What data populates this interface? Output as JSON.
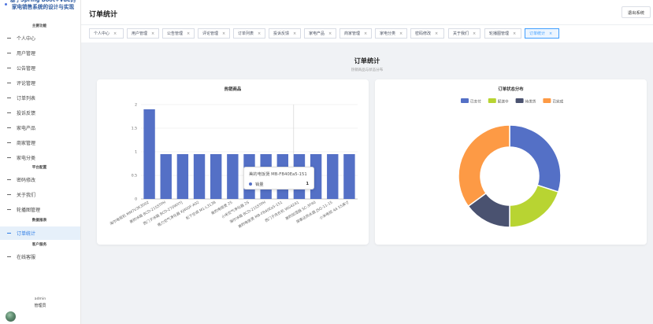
{
  "sidebar": {
    "brand": "基于Spring Boot+Vue的家电销售系统的设计与实现",
    "groups": [
      "主要功能",
      "平台配置",
      "数据报表",
      "客户服务"
    ],
    "items": [
      {
        "label": "个人中心"
      },
      {
        "label": "用户管理"
      },
      {
        "label": "公告管理"
      },
      {
        "label": "评论管理"
      },
      {
        "label": "订单列表"
      },
      {
        "label": "投诉反馈"
      },
      {
        "label": "家电产品"
      },
      {
        "label": "商家管理"
      },
      {
        "label": "家电分类"
      },
      {
        "label": "密码修改"
      },
      {
        "label": "关于我们"
      },
      {
        "label": "轮播图管理"
      },
      {
        "label": "订单统计"
      },
      {
        "label": "在线客服"
      }
    ],
    "active_item": "订单统计",
    "user": {
      "name": "admin",
      "role": "管理员"
    }
  },
  "header": {
    "title": "订单统计",
    "logout_label": "退出系统"
  },
  "tabs": [
    {
      "label": "个人中心"
    },
    {
      "label": "用户管理"
    },
    {
      "label": "公告管理"
    },
    {
      "label": "评论管理"
    },
    {
      "label": "订单列表"
    },
    {
      "label": "投诉反馈"
    },
    {
      "label": "家电产品"
    },
    {
      "label": "商家管理"
    },
    {
      "label": "家电分类"
    },
    {
      "label": "密码修改"
    },
    {
      "label": "关于我们"
    },
    {
      "label": "轮播图管理"
    },
    {
      "label": "订单统计"
    }
  ],
  "tab_close_glyph": "×",
  "main": {
    "title": "订单统计",
    "subtitle": "热销商品与状态分布"
  },
  "chart_data": [
    {
      "type": "bar",
      "title": "热销商品",
      "categories": [
        "海尔电视机 MM7V3K3D02",
        "美的冰箱 BCD-215STPH",
        "西门子冰箱 BCD-270WXYJ",
        "格力空气净化器 KJ400F-A02",
        "松下空调 M1-L313B",
        "美的电饭煲 25",
        "小米空气净化器 2S",
        "海尔冰箱 BCD-215STPH",
        "美的电饭煲 MB-FB40Ea5-151",
        "西门子洗衣机 WG42A1",
        "美的加湿器 SC-3F40",
        "荣事达热水器 JSQ-11-15",
        "小米电视 4A 55英寸"
      ],
      "values": [
        1.9,
        0.95,
        0.95,
        0.95,
        0.95,
        0.95,
        0.95,
        0.95,
        0.95,
        0.95,
        0.95,
        0.95,
        0.95
      ],
      "ylim": [
        0,
        2
      ],
      "yticks": [
        "0",
        "0.5",
        "1",
        "1.5",
        "2"
      ],
      "ytick_values": [
        0,
        0.5,
        1,
        1.5,
        2
      ],
      "color": "#5470c6",
      "tooltip": {
        "title": "美的电饭煲 MB-FB40Ea5-151",
        "series": "销量",
        "value": "1"
      }
    },
    {
      "type": "pie",
      "title": "订单状态分布",
      "legend_position": "top",
      "slices": [
        {
          "name": "已支付",
          "value": 30,
          "color": "#5470c6"
        },
        {
          "name": "配送中",
          "value": 20,
          "color": "#b8d432"
        },
        {
          "name": "待发货",
          "value": 15,
          "color": "#4a5270"
        },
        {
          "name": "已完成",
          "value": 35,
          "color": "#fd9a45"
        }
      ]
    }
  ]
}
